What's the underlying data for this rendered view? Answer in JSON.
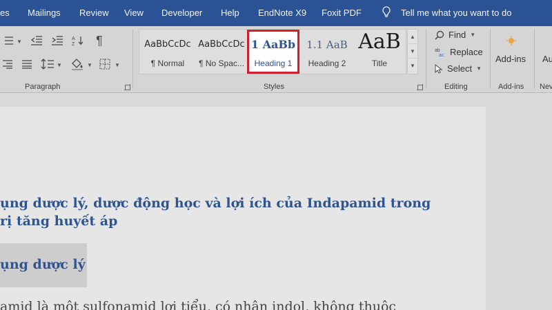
{
  "tabs": [
    "es",
    "Mailings",
    "Review",
    "View",
    "Developer",
    "Help",
    "EndNote X9",
    "Foxit PDF"
  ],
  "tell_me": "Tell me what you want to do",
  "groups": {
    "paragraph": "Paragraph",
    "styles": "Styles",
    "editing": "Editing",
    "addins": "Add-ins",
    "next": "Nev"
  },
  "styles": [
    {
      "preview": "AaBbCcDc",
      "label": "¶ Normal"
    },
    {
      "preview": "AaBbCcDc",
      "label": "¶ No Spac..."
    },
    {
      "preview": "1  AaBb",
      "label": "Heading 1"
    },
    {
      "preview": "1.1  AaB",
      "label": "Heading 2"
    },
    {
      "preview": "AaB",
      "label": "Title"
    }
  ],
  "editing": {
    "find": "Find",
    "replace": "Replace",
    "select": "Select"
  },
  "addins": {
    "label": "Add-ins",
    "partial": "Au"
  },
  "document": {
    "heading_line1": "ụng dược lý, dược động học và lợi ích của Indapamid trong",
    "heading_line2": "rị tăng huyết áp",
    "subheading": "ụng dược lý",
    "body_line": "amid là một sulfonamid lợi tiểu, có nhân indol, không thuộc"
  },
  "colors": {
    "tabbar": "#2a5295",
    "selection": "#d0202e",
    "heading": "#2f5490"
  }
}
